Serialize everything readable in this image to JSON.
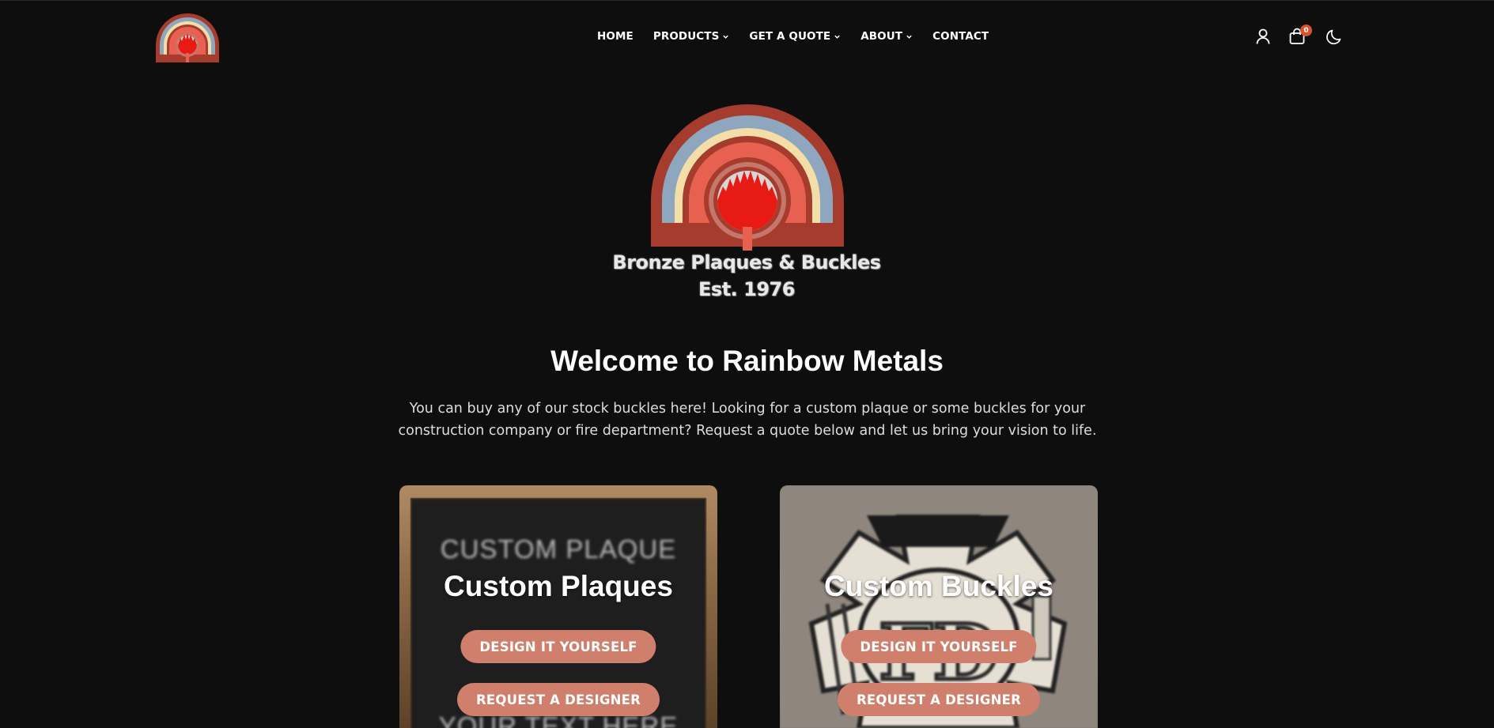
{
  "nav": {
    "items": [
      {
        "label": "HOME",
        "has_dropdown": false
      },
      {
        "label": "PRODUCTS",
        "has_dropdown": true
      },
      {
        "label": "GET A QUOTE",
        "has_dropdown": true
      },
      {
        "label": "ABOUT",
        "has_dropdown": true
      },
      {
        "label": "CONTACT",
        "has_dropdown": false
      }
    ]
  },
  "header_icons": [
    "user-icon",
    "shopping-bag-icon",
    "moon-icon"
  ],
  "cart": {
    "count": "0"
  },
  "hero": {
    "logo_line1": "Bronze Plaques & Buckles",
    "logo_line2": "Est. 1976",
    "title": "Welcome to Rainbow Metals",
    "intro": "You can buy any of our stock buckles here! Looking for a custom plaque or some buckles for your construction company or fire department? Request a quote below and let us bring your vision to life."
  },
  "cards": [
    {
      "title": "Custom Plaques",
      "image_text_top": "CUSTOM PLAQUE",
      "image_text_bottom": "YOUR TEXT HERE",
      "button1": "DESIGN IT YOURSELF",
      "button2": "REQUEST A DESIGNER"
    },
    {
      "title": "Custom Buckles",
      "image_text": "FD",
      "button1": "DESIGN IT YOURSELF",
      "button2": "REQUEST A DESIGNER"
    }
  ],
  "colors": {
    "background": "#0e0e0e",
    "button": "#cf7f6b",
    "badge": "#d9502a",
    "rainbow_outer": "#a53c2e",
    "rainbow_blue": "#8fa6bf",
    "rainbow_cream": "#f3dea8",
    "rainbow_coral": "#e8604f",
    "flame_red": "#e81b14"
  }
}
